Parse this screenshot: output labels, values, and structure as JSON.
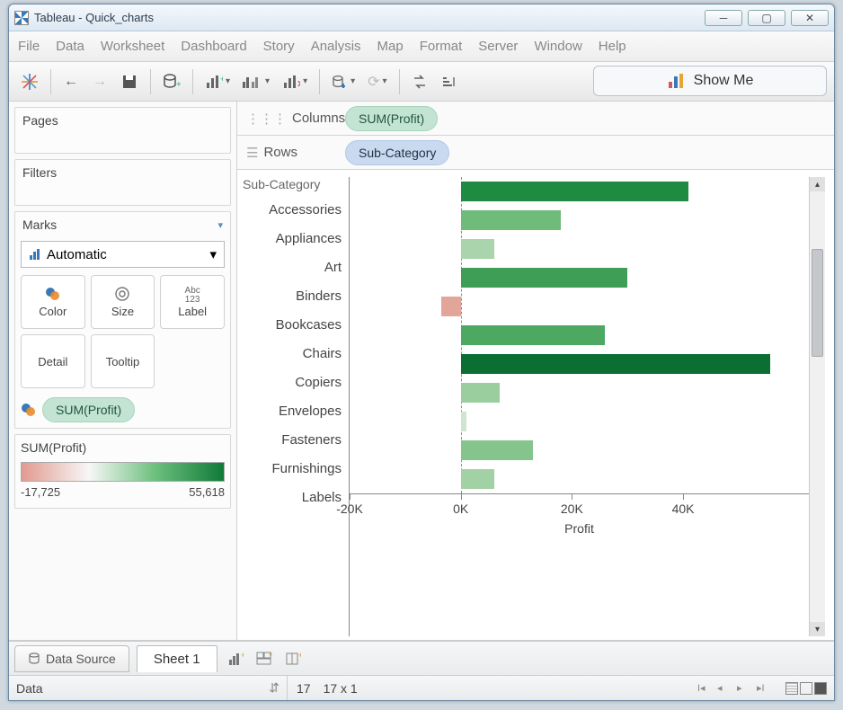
{
  "window": {
    "title": "Tableau - Quick_charts"
  },
  "menu": [
    "File",
    "Data",
    "Worksheet",
    "Dashboard",
    "Story",
    "Analysis",
    "Map",
    "Format",
    "Server",
    "Window",
    "Help"
  ],
  "toolbar": {
    "show_me": "Show Me"
  },
  "sidebar": {
    "pages_title": "Pages",
    "filters_title": "Filters",
    "marks_title": "Marks",
    "marks_dropdown": "Automatic",
    "cards": [
      "Color",
      "Size",
      "Label",
      "Detail",
      "Tooltip"
    ],
    "mark_pill": "SUM(Profit)",
    "legend_title": "SUM(Profit)",
    "legend_min": "-17,725",
    "legend_max": "55,618"
  },
  "shelves": {
    "columns_label": "Columns",
    "columns_pill": "SUM(Profit)",
    "rows_label": "Rows",
    "rows_pill": "Sub-Category"
  },
  "chart_data": {
    "type": "bar",
    "title": "Sub-Category",
    "xlabel": "Profit",
    "ylabel": "",
    "xlim": [
      -20000,
      56000
    ],
    "xticks": [
      -20000,
      0,
      20000,
      40000
    ],
    "xtick_labels": [
      "-20K",
      "0K",
      "20K",
      "40K"
    ],
    "categories": [
      "Accessories",
      "Appliances",
      "Art",
      "Binders",
      "Bookcases",
      "Chairs",
      "Copiers",
      "Envelopes",
      "Fasteners",
      "Furnishings",
      "Labels"
    ],
    "values": [
      41000,
      18000,
      6000,
      30000,
      -3500,
      26000,
      55618,
      7000,
      1000,
      13000,
      6000
    ],
    "colors": [
      "#1f8a42",
      "#6fbb7a",
      "#a9d4ac",
      "#3f9e55",
      "#e2a59a",
      "#4da862",
      "#0b6e32",
      "#9bce9f",
      "#cfe5cf",
      "#85c48c",
      "#a3d1a6"
    ]
  },
  "tabs": {
    "data_source": "Data Source",
    "sheet1": "Sheet 1"
  },
  "status": {
    "left": "Data",
    "marks": "17",
    "dims": "17 x 1"
  }
}
